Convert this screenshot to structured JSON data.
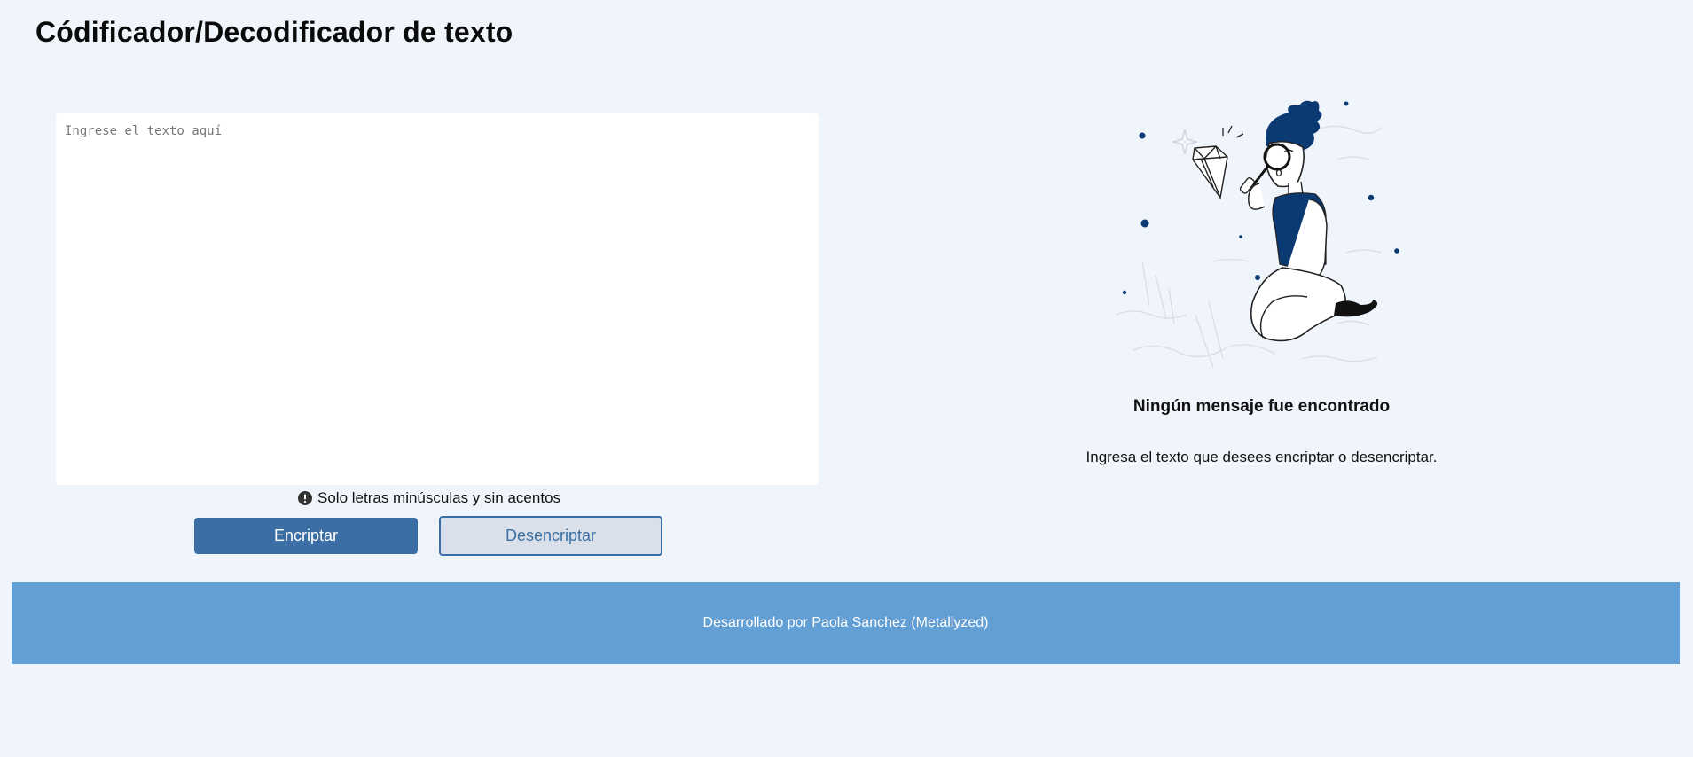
{
  "header": {
    "title": "Códificador/Decodificador de texto"
  },
  "editor": {
    "placeholder": "Ingrese el texto aquí",
    "value": "",
    "hint_icon": "exclamation-circle-icon",
    "hint": "Solo letras minúsculas y sin acentos"
  },
  "actions": {
    "encrypt_label": "Encriptar",
    "decrypt_label": "Desencriptar"
  },
  "result": {
    "illustration": "person-with-magnifier-and-diamond",
    "title": "Ningún mensaje fue encontrado",
    "subtitle": "Ingresa el texto que desees encriptar o desencriptar."
  },
  "footer": {
    "text": "Desarrollado por Paola Sanchez (Metallyzed)"
  },
  "colors": {
    "background": "#f0f4fb",
    "primary": "#3a6ea5",
    "secondary_bg": "#d9e0ea",
    "footer_bg": "#629fd4",
    "illustration_accent": "#0b3a73"
  }
}
